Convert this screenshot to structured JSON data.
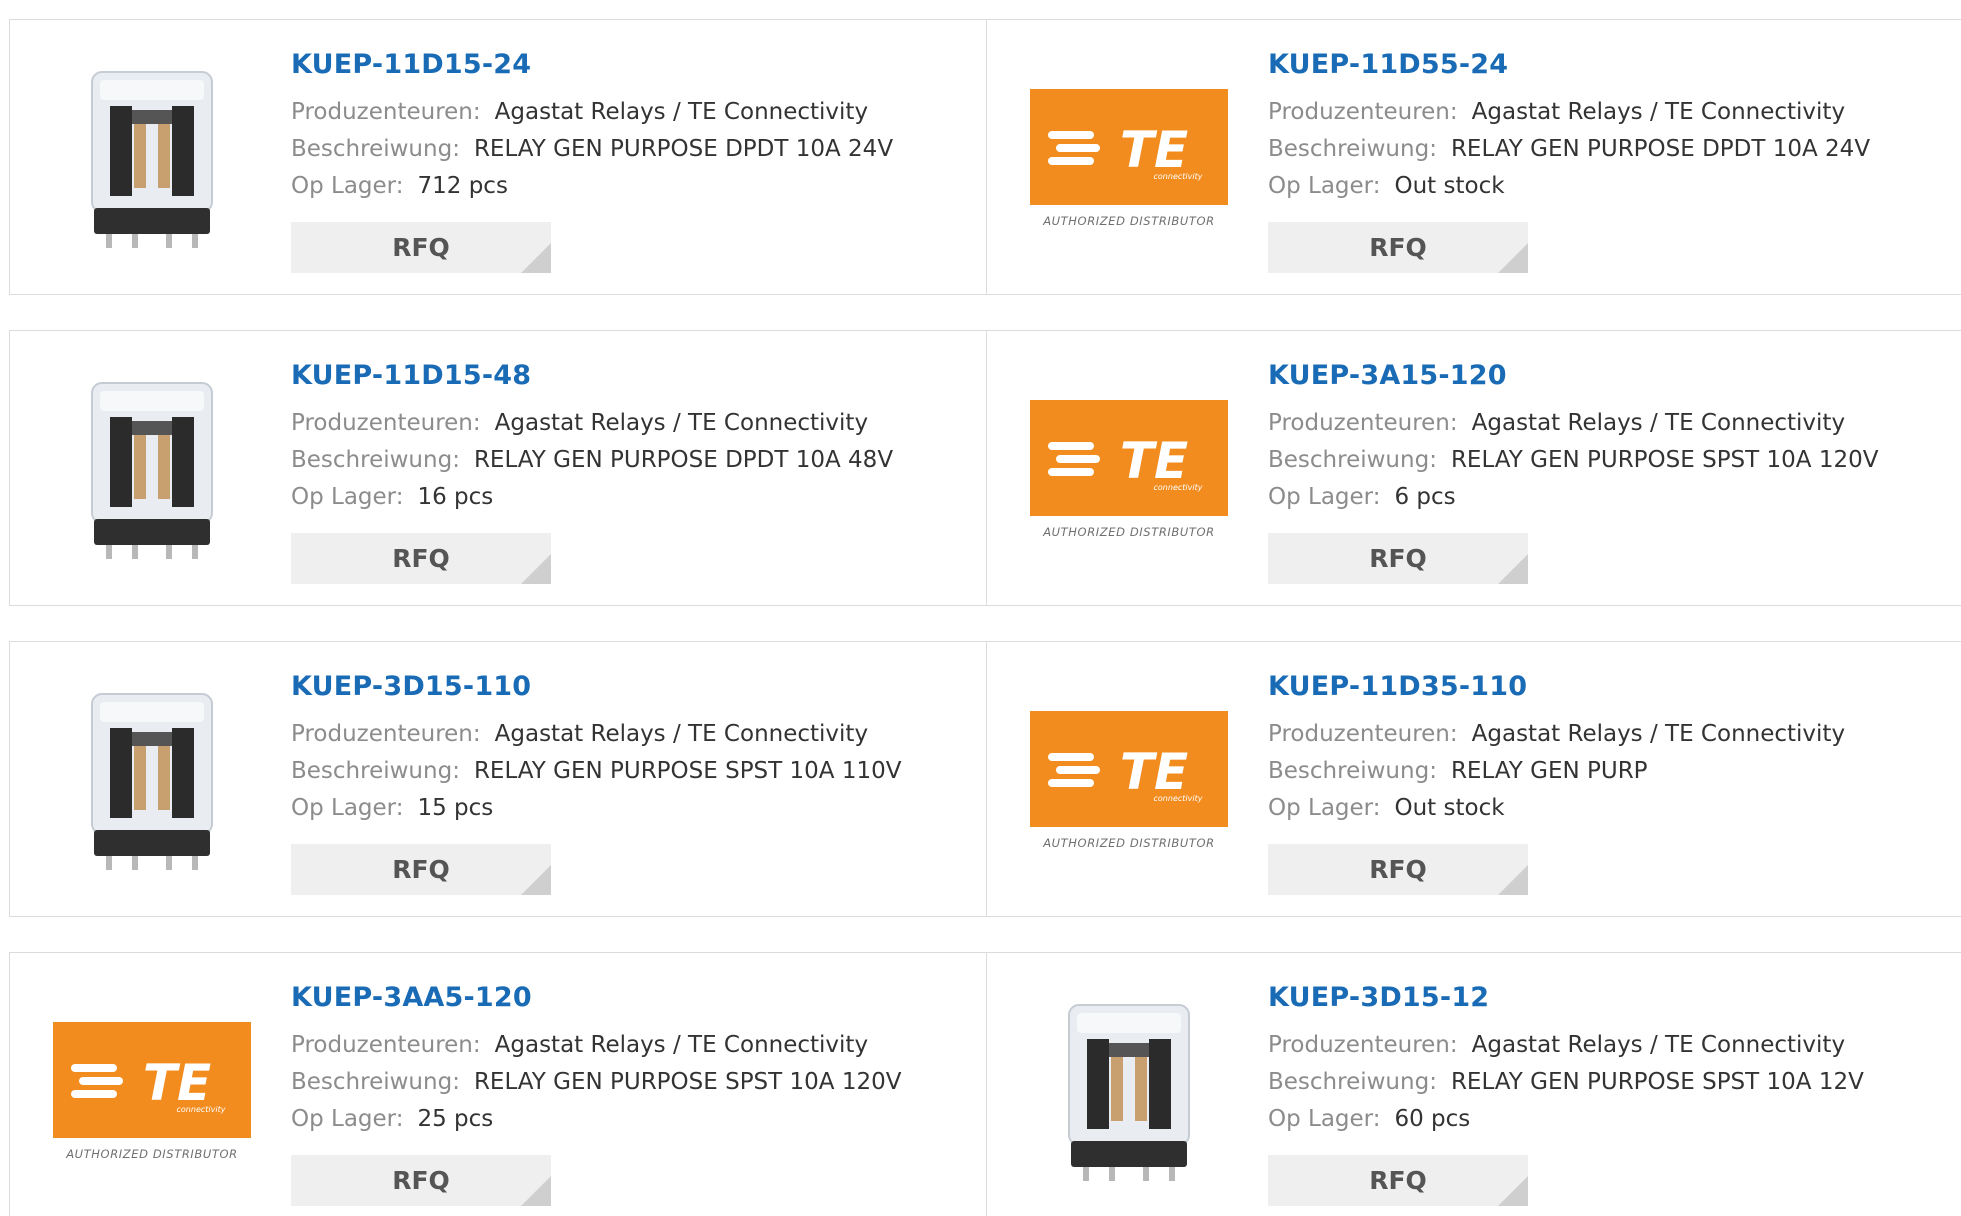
{
  "labels": {
    "manufacturer": "Produzenteuren:",
    "description": "Beschreiwung:",
    "stock": "Op Lager:",
    "rfq": "RFQ",
    "logo_caption": "AUTHORIZED DISTRIBUTOR",
    "logo_text": "TE",
    "logo_sub": "connectivity"
  },
  "colors": {
    "link": "#1a6bb5",
    "te_orange": "#f28c1e",
    "label_gray": "#8c8c8c"
  },
  "products": [
    {
      "part": "KUEP-11D15-24",
      "manufacturer": "Agastat Relays / TE Connectivity",
      "description": "RELAY GEN PURPOSE DPDT 10A 24V",
      "stock": "712 pcs",
      "image": "relay-photo"
    },
    {
      "part": "KUEP-11D55-24",
      "manufacturer": "Agastat Relays / TE Connectivity",
      "description": "RELAY GEN PURPOSE DPDT 10A 24V",
      "stock": "Out stock",
      "image": "te-logo"
    },
    {
      "part": "KUEP-11D15-48",
      "manufacturer": "Agastat Relays / TE Connectivity",
      "description": "RELAY GEN PURPOSE DPDT 10A 48V",
      "stock": "16 pcs",
      "image": "relay-photo"
    },
    {
      "part": "KUEP-3A15-120",
      "manufacturer": "Agastat Relays / TE Connectivity",
      "description": "RELAY GEN PURPOSE SPST 10A 120V",
      "stock": "6 pcs",
      "image": "te-logo"
    },
    {
      "part": "KUEP-3D15-110",
      "manufacturer": "Agastat Relays / TE Connectivity",
      "description": "RELAY GEN PURPOSE SPST 10A 110V",
      "stock": "15 pcs",
      "image": "relay-photo"
    },
    {
      "part": "KUEP-11D35-110",
      "manufacturer": "Agastat Relays / TE Connectivity",
      "description": "RELAY GEN PURP",
      "stock": "Out stock",
      "image": "te-logo"
    },
    {
      "part": "KUEP-3AA5-120",
      "manufacturer": "Agastat Relays / TE Connectivity",
      "description": "RELAY GEN PURPOSE SPST 10A 120V",
      "stock": "25 pcs",
      "image": "te-logo"
    },
    {
      "part": "KUEP-3D15-12",
      "manufacturer": "Agastat Relays / TE Connectivity",
      "description": "RELAY GEN PURPOSE SPST 10A 12V",
      "stock": "60 pcs",
      "image": "relay-photo"
    }
  ]
}
